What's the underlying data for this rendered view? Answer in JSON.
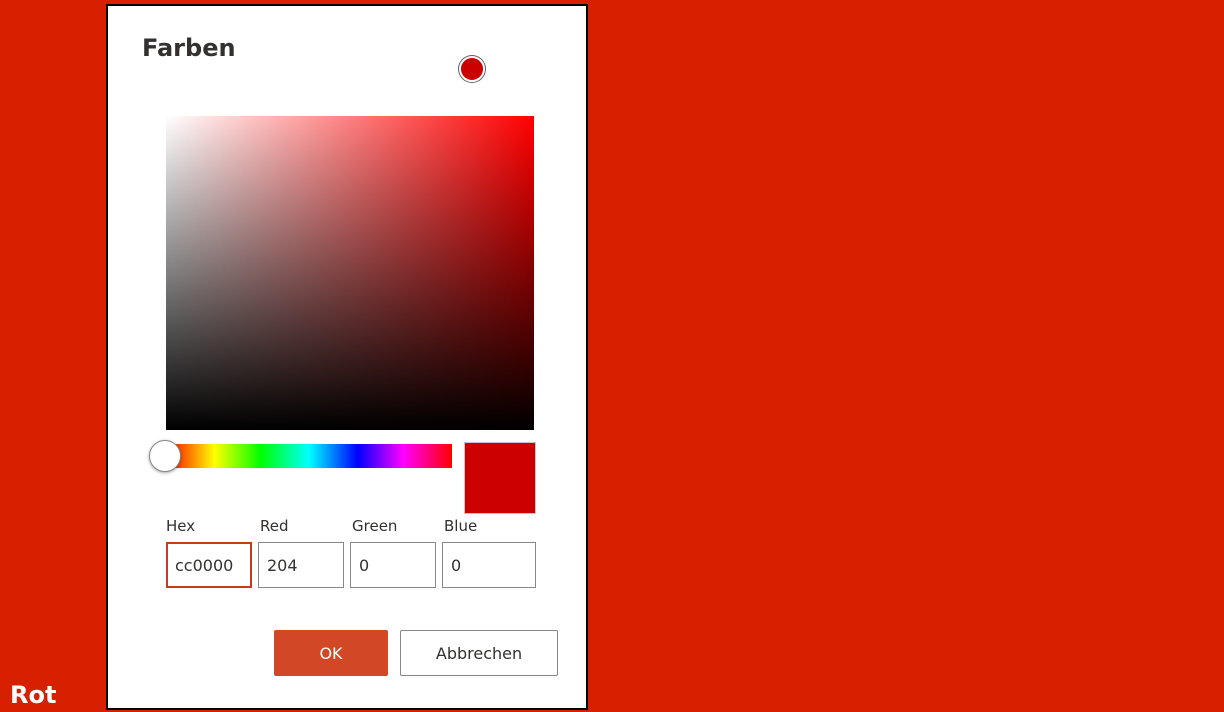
{
  "swatch": {
    "label": "Rot",
    "background_color": "#d62000"
  },
  "dialog": {
    "title": "Farben",
    "selected_color": "#cc0000",
    "hue_color": "#ff0000",
    "hue_position": 0,
    "fields": {
      "hex": {
        "label": "Hex",
        "value": "cc0000"
      },
      "red": {
        "label": "Red",
        "value": "204"
      },
      "green": {
        "label": "Green",
        "value": "0"
      },
      "blue": {
        "label": "Blue",
        "value": "0"
      }
    },
    "buttons": {
      "ok": "OK",
      "cancel": "Abbrechen"
    },
    "accent_color": "#d24726"
  }
}
